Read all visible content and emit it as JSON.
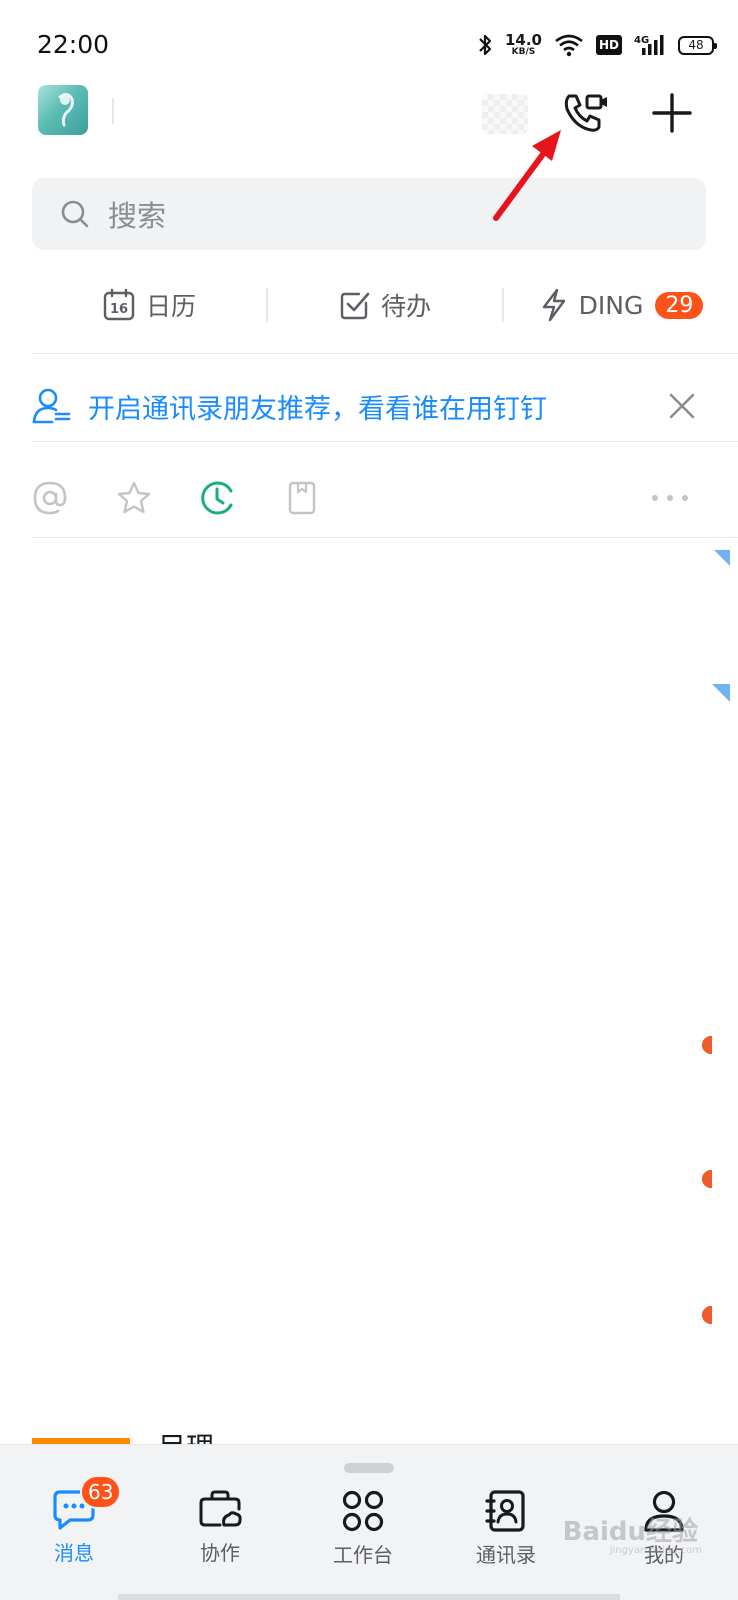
{
  "status_bar": {
    "time": "22:00",
    "net_speed_value": "14.0",
    "net_speed_unit": "KB/S",
    "hd_label": "HD",
    "network_label": "4G",
    "battery_level": "48"
  },
  "search": {
    "placeholder": "搜索"
  },
  "quick_actions": {
    "calendar_label": "日历",
    "calendar_day": "16",
    "todo_label": "待办",
    "ding_label": "DING",
    "ding_count": "29"
  },
  "banner": {
    "text": "开启通讯录朋友推荐，看看谁在用钉钉"
  },
  "partial_row": {
    "title": "目理"
  },
  "tabbar": {
    "tabs": [
      {
        "label": "消息",
        "badge": "63",
        "active": true
      },
      {
        "label": "协作"
      },
      {
        "label": "工作台"
      },
      {
        "label": "通讯录"
      },
      {
        "label": "我的"
      }
    ]
  },
  "watermark": {
    "brand": "Baidu经验",
    "url": "jingyan.baidu.com"
  },
  "colors": {
    "accent": "#1a8cff",
    "badge": "#ff5219",
    "recent_icon": "#1aad7e",
    "annotation_arrow": "#e8141b"
  },
  "icons": [
    "avatar",
    "video-call-icon",
    "plus-icon",
    "search-icon",
    "calendar-icon",
    "todo-check-icon",
    "ding-bolt-icon",
    "contact-recommend-icon",
    "close-icon",
    "at-icon",
    "star-icon",
    "recent-clock-icon",
    "bookmark-icon",
    "more-dots-icon",
    "message-tab-icon",
    "collab-tab-icon",
    "workbench-tab-icon",
    "contacts-tab-icon",
    "profile-tab-icon"
  ]
}
